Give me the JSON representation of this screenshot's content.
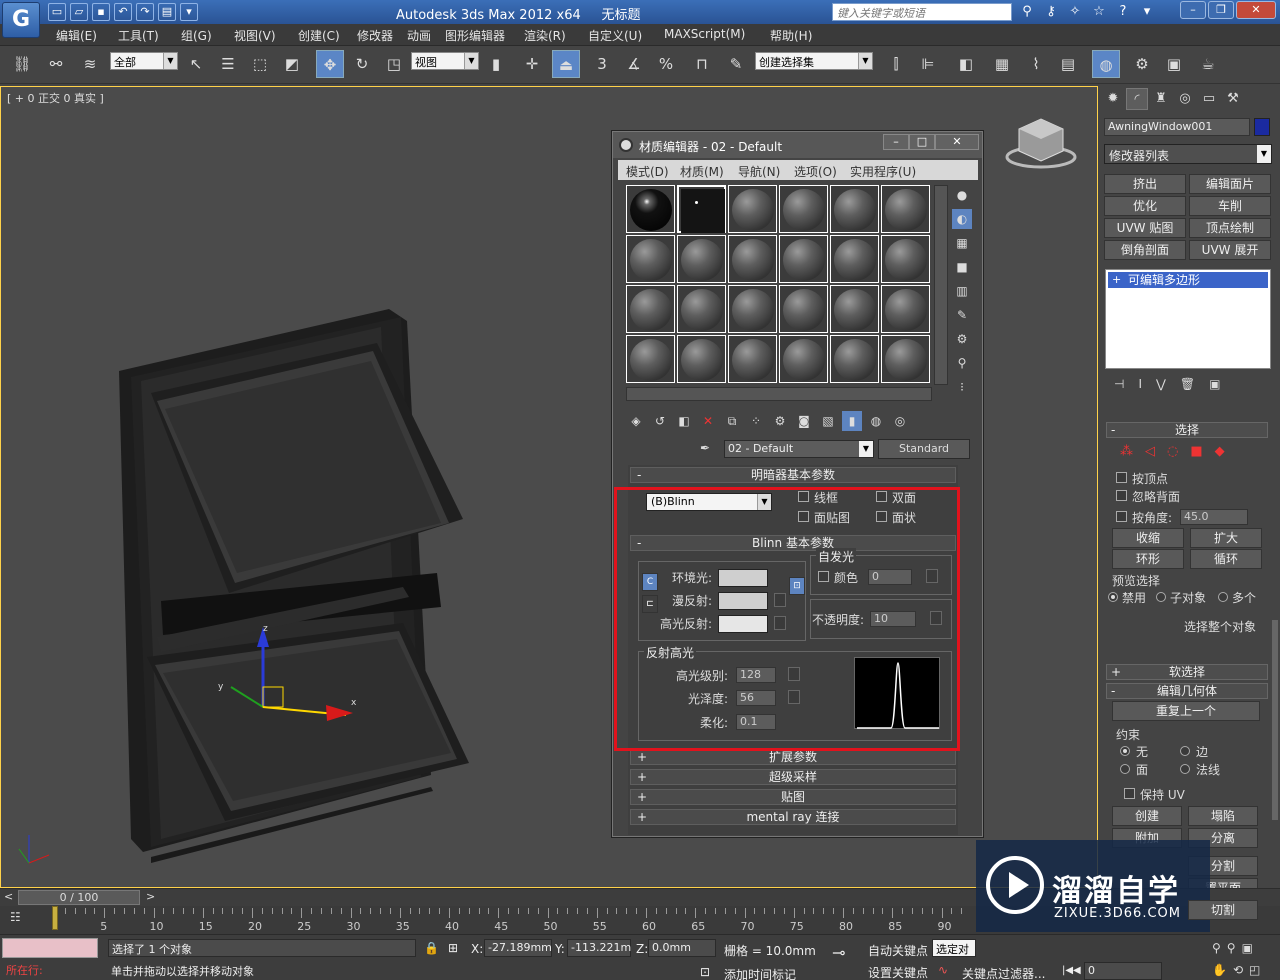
{
  "titlebar": {
    "app_title": "Autodesk 3ds Max  2012 x64",
    "doc_title": "无标题",
    "search_placeholder": "键入关键字或短语"
  },
  "menu": [
    "编辑(E)",
    "工具(T)",
    "组(G)",
    "视图(V)",
    "创建(C)",
    "修改器",
    "动画",
    "图形编辑器",
    "渲染(R)",
    "自定义(U)",
    "MAXScript(M)",
    "帮助(H)"
  ],
  "toolbar": {
    "selection_filter": "全部",
    "ref_coord": "视图",
    "named_selection": "创建选择集",
    "snap_3": "3",
    "percent_snap": "%"
  },
  "viewport": {
    "label": "[ + 0 正交 0 真实 ]",
    "axis_labels": {
      "x": "x",
      "y": "y",
      "z": "z"
    }
  },
  "cmdpanel": {
    "object_name": "AwningWindow001",
    "object_color": "#1a2aa0",
    "modifier_list": "修改器列表",
    "buttons": [
      "挤出",
      "编辑面片",
      "优化",
      "车削",
      "UVW 贴图",
      "顶点绘制",
      "倒角剖面",
      "UVW 展开"
    ],
    "stack_item": "可编辑多边形",
    "selection": {
      "title": "选择",
      "by_vertex": "按顶点",
      "ignore_backface": "忽略背面",
      "by_angle": "按角度:",
      "angle_value": "45.0",
      "shrink": "收缩",
      "grow": "扩大",
      "ring": "环形",
      "loop": "循环",
      "preview_title": "预览选择",
      "preview_off": "禁用",
      "preview_subobj": "子对象",
      "preview_multi": "多个",
      "select_whole": "选择整个对象"
    },
    "soft_selection": "软选择",
    "edit_geometry": {
      "title": "编辑几何体",
      "repeat_last": "重复上一个",
      "constraints_title": "约束",
      "none": "无",
      "edge": "边",
      "face": "面",
      "normal": "法线",
      "preserve_uv": "保持 UV",
      "create": "创建",
      "collapse": "塌陷",
      "attach": "附加",
      "detach": "分离",
      "split": "分割",
      "make_planar": "置平面",
      "cut": "切割"
    }
  },
  "material_editor": {
    "title": "材质编辑器 - 02 - Default",
    "menu": [
      "模式(D)",
      "材质(M)",
      "导航(N)",
      "选项(O)",
      "实用程序(U)"
    ],
    "material_name": "02 - Default",
    "material_type": "Standard",
    "shader_rollout": "明暗器基本参数",
    "shader": "(B)Blinn",
    "wire": "线框",
    "two_sided": "双面",
    "face_map": "面贴图",
    "faceted": "面状",
    "blinn_rollout": "Blinn 基本参数",
    "self_illum_title": "自发光",
    "color_label": "颜色",
    "self_illum_value": "0",
    "ambient": "环境光:",
    "diffuse": "漫反射:",
    "specular": "高光反射:",
    "opacity_label": "不透明度:",
    "opacity_value": "10",
    "spec_hl_title": "反射高光",
    "spec_level_label": "高光级别:",
    "spec_level": "128",
    "glossiness_label": "光泽度:",
    "glossiness": "56",
    "soften_label": "柔化:",
    "soften": "0.1",
    "rollouts": [
      "扩展参数",
      "超级采样",
      "贴图",
      "mental ray 连接"
    ]
  },
  "timeline": {
    "frame_display": "0 / 100",
    "ticks": [
      "0",
      "5",
      "10",
      "15",
      "20",
      "25",
      "30",
      "35",
      "40",
      "45",
      "50",
      "55",
      "60",
      "65",
      "70",
      "75",
      "80",
      "85",
      "90"
    ]
  },
  "statusbar": {
    "now_doing": "所在行:",
    "selected": "选择了 1 个对象",
    "prompt": "单击并拖动以选择并移动对象",
    "x_label": "X:",
    "x_value": "-27.189mm",
    "y_label": "Y:",
    "y_value": "-113.221m",
    "z_label": "Z:",
    "z_value": "0.0mm",
    "grid": "栅格 = 10.0mm",
    "add_time_tag": "添加时间标记",
    "auto_key": "自动关键点",
    "set_key": "设置关键点",
    "selected_obj": "选定对",
    "key_filters": "关键点过滤器...",
    "frame": "0"
  },
  "watermark": {
    "cn": "溜溜自学",
    "en": "ZIXUE.3D66.COM"
  }
}
